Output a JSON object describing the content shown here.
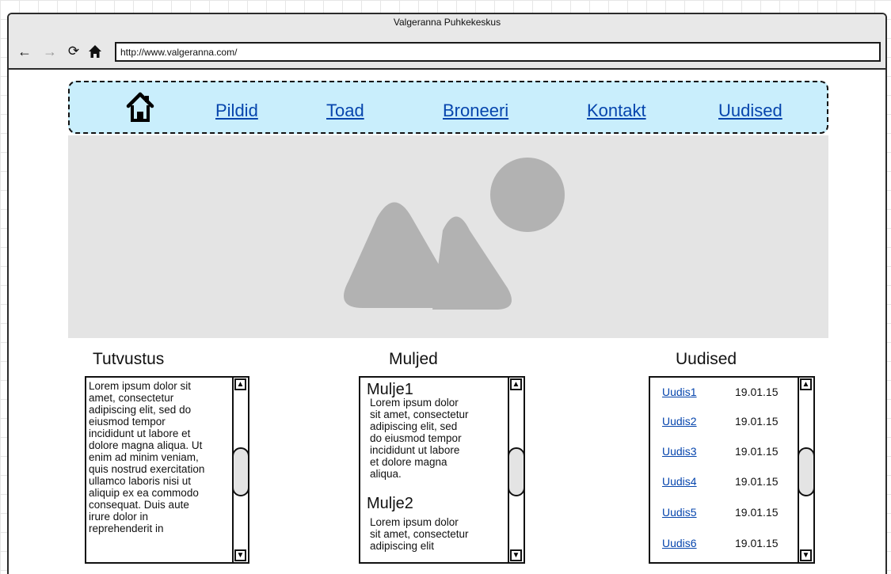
{
  "browser": {
    "window_title": "Valgeranna Puhkekeskus",
    "url": "http://www.valgeranna.com/",
    "back_icon": "←",
    "forward_icon": "→",
    "reload_icon": "⟳"
  },
  "menu": {
    "items": [
      {
        "label": "Pildid"
      },
      {
        "label": "Toad"
      },
      {
        "label": "Broneeri"
      },
      {
        "label": "Kontakt"
      },
      {
        "label": "Uudised"
      }
    ]
  },
  "intro": {
    "title": "Tutvustus",
    "lines": [
      "Lorem ipsum dolor sit",
      "amet, consectetur",
      "adipiscing elit, sed do",
      "eiusmod tempor",
      "incididunt ut labore et",
      "dolore magna aliqua. Ut",
      "enim ad minim veniam,",
      "quis nostrud exercitation",
      "ullamco laboris nisi ut",
      "aliquip ex ea commodo",
      "consequat. Duis aute",
      "irure dolor in",
      "reprehenderit in"
    ]
  },
  "impressions": {
    "title": "Muljed",
    "entries": [
      {
        "title": "Mulje1",
        "lines": [
          "Lorem ipsum dolor",
          "sit amet, consectetur",
          "adipiscing elit, sed",
          "do eiusmod tempor",
          "incididunt ut labore",
          "et dolore magna",
          "aliqua."
        ]
      },
      {
        "title": "Mulje2",
        "lines": [
          "Lorem ipsum dolor",
          "sit amet, consectetur",
          "adipiscing elit"
        ]
      }
    ]
  },
  "news": {
    "title": "Uudised",
    "items": [
      {
        "link": "Uudis1",
        "date": "19.01.15"
      },
      {
        "link": "Uudis2",
        "date": "19.01.15"
      },
      {
        "link": "Uudis3",
        "date": "19.01.15"
      },
      {
        "link": "Uudis4",
        "date": "19.01.15"
      },
      {
        "link": "Uudis5",
        "date": "19.01.15"
      },
      {
        "link": "Uudis6",
        "date": "19.01.15"
      }
    ]
  },
  "scroll": {
    "up_icon": "▲",
    "down_icon": "▼"
  },
  "colors": {
    "menu_bg": "#c9eefc",
    "link": "#0645ad",
    "hero_bg": "#e4e4e4",
    "hero_shape": "#b2b2b2",
    "chrome_bg": "#e8e8e8"
  }
}
